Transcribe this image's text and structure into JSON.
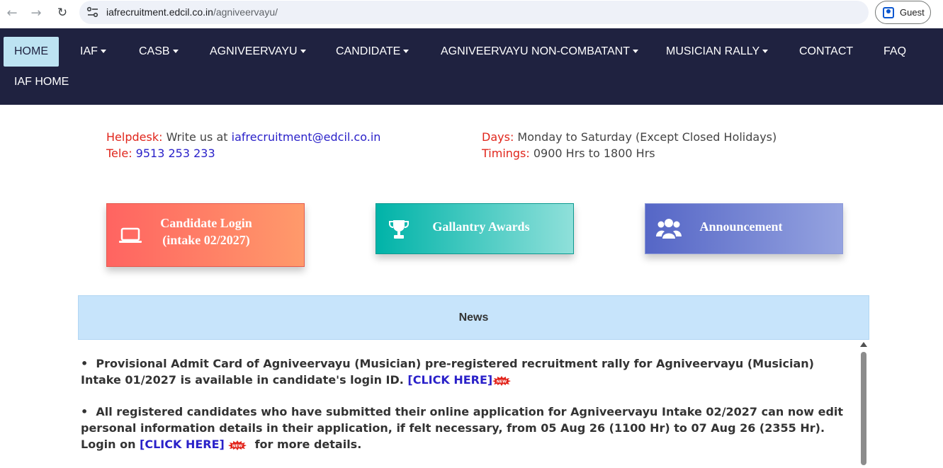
{
  "browser": {
    "url_host": "iafrecruitment.edcil.co.in",
    "url_path": "/agniveervayu/",
    "profile_label": "Guest"
  },
  "nav": {
    "items": [
      {
        "label": "HOME"
      },
      {
        "label": "IAF"
      },
      {
        "label": "CASB"
      },
      {
        "label": "AGNIVEERVAYU"
      },
      {
        "label": "CANDIDATE"
      },
      {
        "label": "AGNIVEERVAYU NON-COMBATANT"
      },
      {
        "label": "MUSICIAN RALLY"
      },
      {
        "label": "CONTACT"
      },
      {
        "label": "FAQ"
      },
      {
        "label": "IAF HOME"
      }
    ]
  },
  "helpdesk": {
    "helpdesk_label": "Helpdesk",
    "helpdesk_text": "Write us at",
    "email": "iafrecruitment@edcil.co.in",
    "tele_label": "Tele",
    "tele_value": "9513 253 233",
    "days_label": "Days",
    "days_value": "Monday to Saturday (Except Closed Holidays)",
    "timings_label": "Timings",
    "timings_value": "0900 Hrs to 1800 Hrs"
  },
  "features": {
    "login_line1": "Candidate Login",
    "login_line2": "(intake 02/2027)",
    "awards": "Gallantry Awards",
    "announcement": "Announcement"
  },
  "news": {
    "title": "News",
    "bullet": "•",
    "item1_text": "Provisional Admit Card of Agniveervayu (Musician) pre-registered recruitment rally for Agniveervayu (Musician) Intake 01/2027 is available in candidate's login ID.",
    "item1_link": "[CLICK HERE]",
    "item2_text": "All registered candidates who have submitted their online application for Agniveervayu Intake 02/2027 can now edit personal information details in their application, if felt necessary, from 05 Aug 26 (1100 Hr) to 07 Aug 26 (2355 Hr). Login on",
    "item2_link": "[CLICK HERE]",
    "item2_suffix": "for more details.",
    "badge_text": "NEW"
  },
  "colors": {
    "navbar": "#1f2240",
    "label_red": "#e0251b",
    "link_blue": "#2a21c9",
    "news_header": "#c7e4fb"
  }
}
